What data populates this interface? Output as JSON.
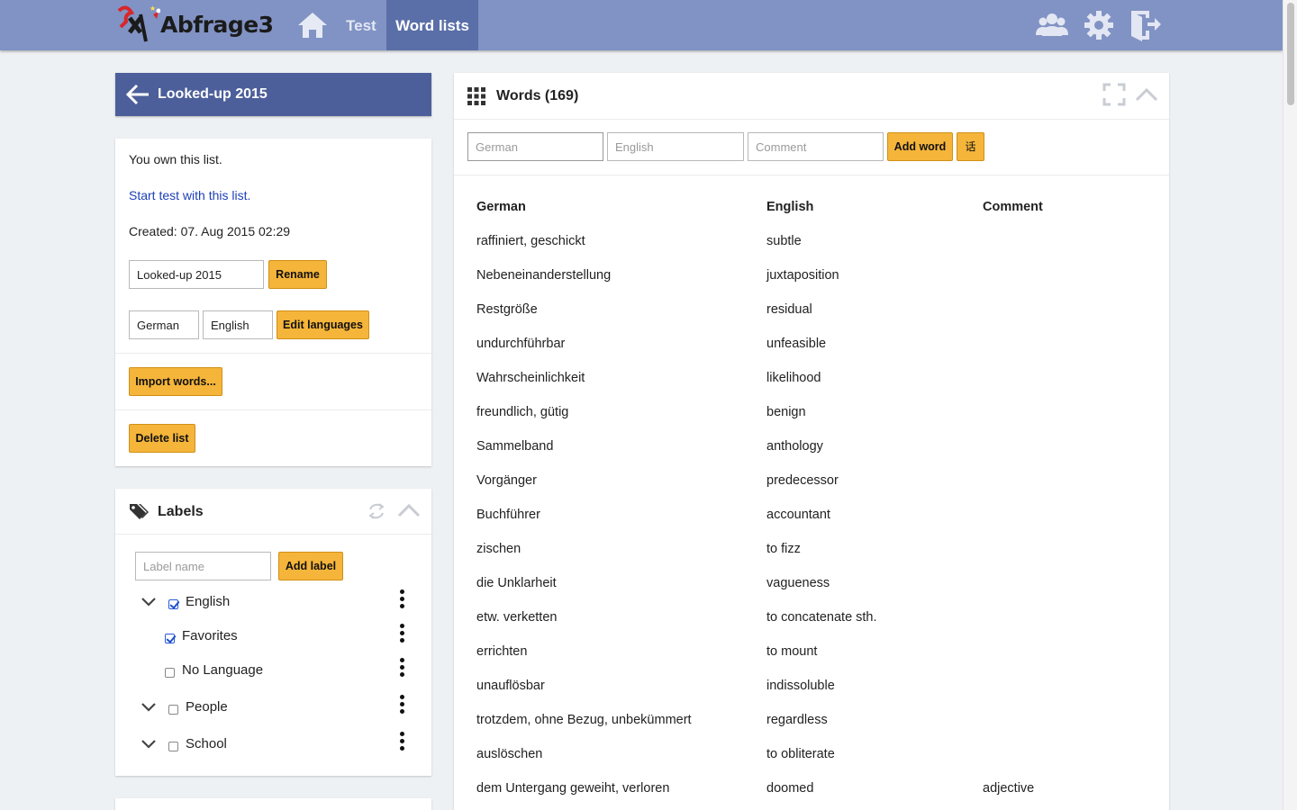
{
  "header": {
    "app_name": "Abfrage3",
    "nav": {
      "home_icon": "home-icon",
      "test_label": "Test",
      "wordlists_label": "Word lists"
    },
    "icons": [
      "users-icon",
      "gear-icon",
      "logout-icon"
    ],
    "colors": {
      "bar": "#8193c4",
      "active_tab": "#5a6fa8"
    }
  },
  "list": {
    "title": "Looked-up 2015",
    "owner_text": "You own this list.",
    "start_test_link": "Start test with this list.",
    "created_text": "Created: 07. Aug 2015 02:29",
    "name_value": "Looked-up 2015",
    "rename_label": "Rename",
    "lang1_value": "German",
    "lang2_value": "English",
    "edit_languages_label": "Edit languages",
    "import_label": "Import words...",
    "delete_label": "Delete list"
  },
  "labels": {
    "title": "Labels",
    "input_placeholder": "Label name",
    "add_label": "Add label",
    "items": [
      {
        "name": "English",
        "checked": true,
        "expandable": true
      },
      {
        "name": "Favorites",
        "checked": true,
        "expandable": false
      },
      {
        "name": "No Language",
        "checked": false,
        "expandable": false
      },
      {
        "name": "People",
        "checked": false,
        "expandable": true
      },
      {
        "name": "School",
        "checked": false,
        "expandable": true
      }
    ]
  },
  "words": {
    "title": "Words (169)",
    "placeholders": {
      "german": "German",
      "english": "English",
      "comment": "Comment"
    },
    "add_word_label": "Add word",
    "special_char_label": "话",
    "columns": [
      "German",
      "English",
      "Comment"
    ],
    "rows": [
      [
        "raffiniert, geschickt",
        "subtle",
        ""
      ],
      [
        "Nebeneinanderstellung",
        "juxtaposition",
        ""
      ],
      [
        "Restgröße",
        "residual",
        ""
      ],
      [
        "undurchführbar",
        "unfeasible",
        ""
      ],
      [
        "Wahrscheinlichkeit",
        "likelihood",
        ""
      ],
      [
        "freundlich, gütig",
        "benign",
        ""
      ],
      [
        "Sammelband",
        "anthology",
        ""
      ],
      [
        "Vorgänger",
        "predecessor",
        ""
      ],
      [
        "Buchführer",
        "accountant",
        ""
      ],
      [
        "zischen",
        "to fizz",
        ""
      ],
      [
        "die Unklarheit",
        "vagueness",
        ""
      ],
      [
        "etw. verketten",
        "to concatenate sth.",
        ""
      ],
      [
        "errichten",
        "to mount",
        ""
      ],
      [
        "unauflösbar",
        "indissoluble",
        ""
      ],
      [
        "trotzdem, ohne Bezug, unbekümmert",
        "regardless",
        ""
      ],
      [
        "auslöschen",
        "to obliterate",
        ""
      ],
      [
        "dem Untergang geweiht, verloren",
        "doomed",
        "adjective"
      ]
    ]
  }
}
